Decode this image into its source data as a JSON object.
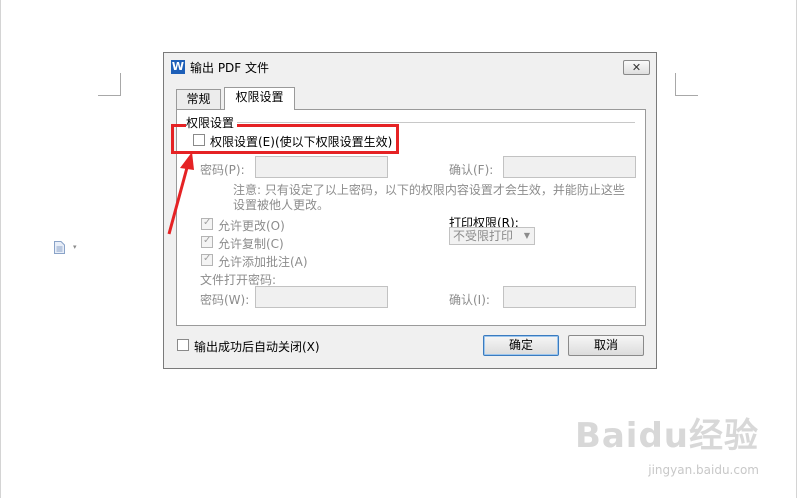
{
  "dialog": {
    "app_icon": "W",
    "title": "输出 PDF 文件",
    "close_icon": "✕"
  },
  "tabs": [
    {
      "label": "常规"
    },
    {
      "label": "权限设置"
    }
  ],
  "permissions": {
    "group_title": "权限设置",
    "enable_label": "权限设置(E)(使以下权限设置生效)",
    "password_label": "密码(P):",
    "confirm_label": "确认(F):",
    "note": "注意: 只有设定了以上密码，以下的权限内容设置才会生效，并能防止这些设置被他人更改。",
    "allow_change": "允许更改(O)",
    "allow_copy": "允许复制(C)",
    "allow_comment": "允许添加批注(A)",
    "print_label": "打印权限(R):",
    "print_value": "不受限打印",
    "open_password_title": "文件打开密码:",
    "open_password_label": "密码(W):",
    "open_confirm_label": "确认(I):"
  },
  "footer": {
    "auto_close_label": "输出成功后自动关闭(X)",
    "ok_label": "确定",
    "cancel_label": "取消"
  },
  "watermark": {
    "brand": "Baidu经验",
    "url": "jingyan.baidu.com"
  },
  "colors": {
    "highlight": "#e52224",
    "app_icon": "#1d5fb8"
  },
  "icons": {
    "doc_icon": "document-icon",
    "caret": "▾",
    "select_arrow": "▼",
    "tick": "✓"
  }
}
